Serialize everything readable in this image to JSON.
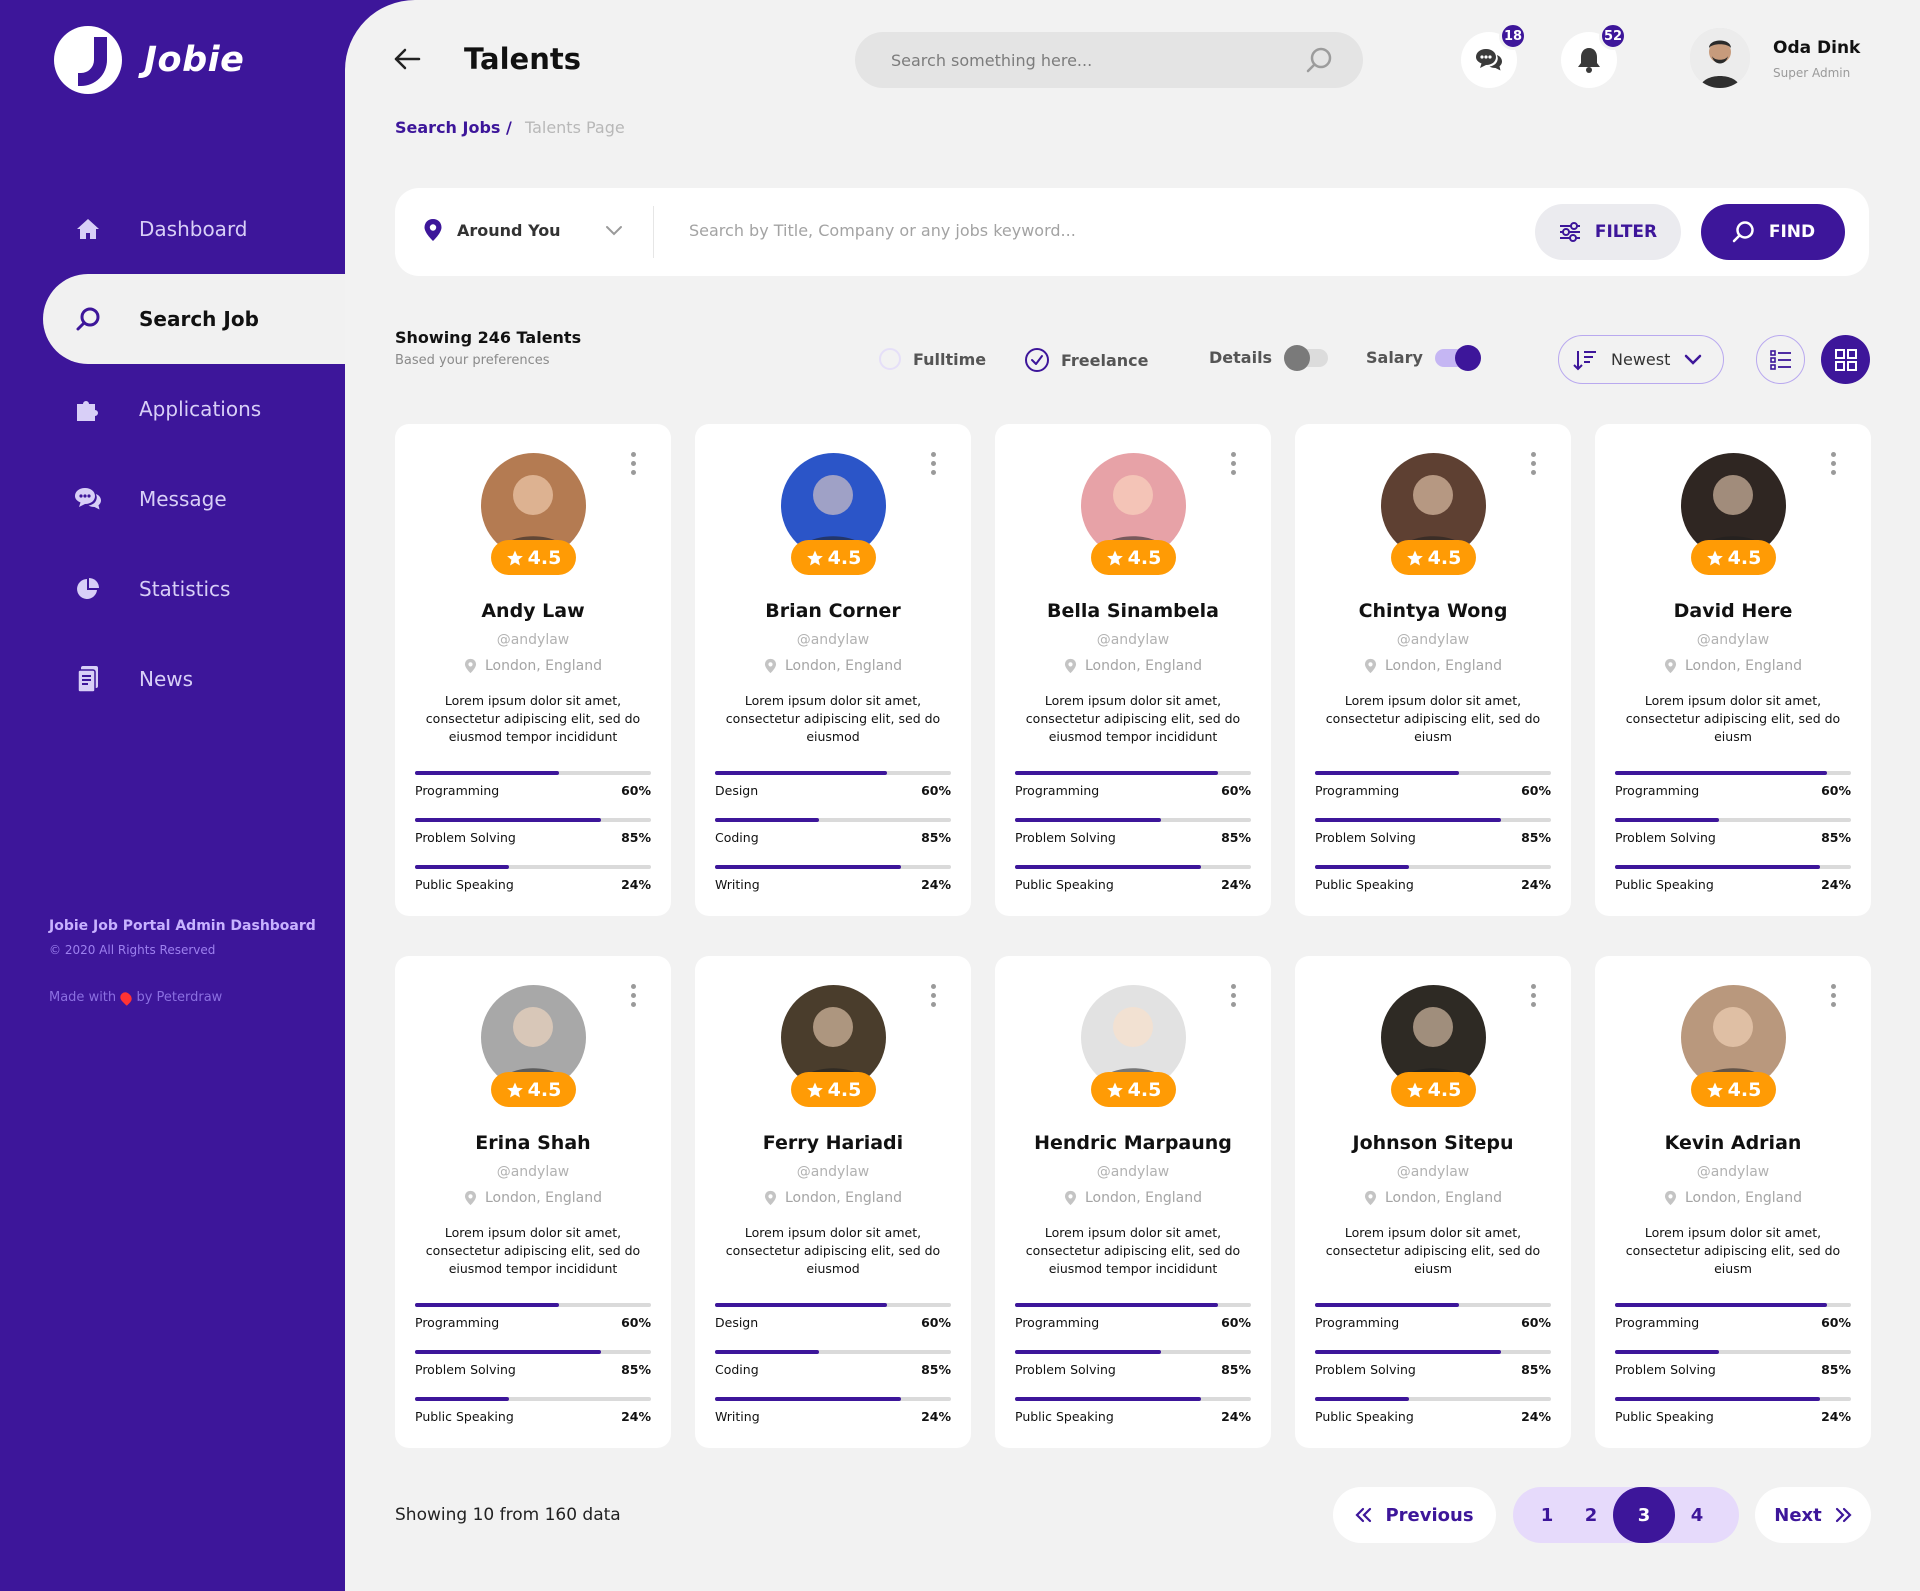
{
  "app": {
    "name": "Jobie"
  },
  "sidebar": {
    "items": [
      {
        "label": "Dashboard",
        "icon": "home-icon",
        "active": false
      },
      {
        "label": "Search Job",
        "icon": "search-icon",
        "active": true
      },
      {
        "label": "Applications",
        "icon": "puzzle-icon",
        "active": false
      },
      {
        "label": "Message",
        "icon": "chat-icon",
        "active": false
      },
      {
        "label": "Statistics",
        "icon": "pie-chart-icon",
        "active": false
      },
      {
        "label": "News",
        "icon": "document-icon",
        "active": false
      }
    ],
    "footer_title": "Jobie Job Portal Admin Dashboard",
    "footer_rights": "© 2020 All Rights Reserved",
    "made_with_prefix": "Made with",
    "made_with_suffix": "by Peterdraw"
  },
  "header": {
    "title": "Talents",
    "search_placeholder": "Search something here...",
    "messages_count": "18",
    "notifications_count": "52",
    "user_name": "Oda Dink",
    "user_role": "Super Admin"
  },
  "breadcrumb": {
    "parent": "Search Jobs /",
    "current": "Talents Page"
  },
  "searchbar": {
    "location": "Around You",
    "keyword_placeholder": "Search by Title, Company or any jobs keyword...",
    "filter_label": "FILTER",
    "find_label": "FIND"
  },
  "results": {
    "title": "Showing 246 Talents",
    "subtitle": "Based your preferences",
    "fulltime_label": "Fulltime",
    "fulltime_checked": false,
    "freelance_label": "Freelance",
    "freelance_checked": true,
    "details_label": "Details",
    "details_on": false,
    "salary_label": "Salary",
    "salary_on": true,
    "sort_label": "Newest"
  },
  "colors": {
    "accent": "#3d169a",
    "rating": "#ff9b05",
    "background": "#f2f2f2"
  },
  "talents": [
    {
      "name": "Andy Law",
      "handle": "@andylaw",
      "location": "London, England",
      "rating": "4.5",
      "desc": "Lorem ipsum dolor sit amet, consectetur adipiscing elit, sed do eiusmod tempor incididunt",
      "avatar_bg": "#b47b52",
      "skills": [
        {
          "label": "Programming",
          "value": "60%",
          "fill": 0.61
        },
        {
          "label": "Problem Solving",
          "value": "85%",
          "fill": 0.79
        },
        {
          "label": "Public Speaking",
          "value": "24%",
          "fill": 0.4
        }
      ]
    },
    {
      "name": "Brian Corner",
      "handle": "@andylaw",
      "location": "London, England",
      "rating": "4.5",
      "desc": "Lorem ipsum dolor sit amet, consectetur adipiscing elit, sed do eiusmod",
      "avatar_bg": "#2b55c8",
      "skills": [
        {
          "label": "Design",
          "value": "60%",
          "fill": 0.73
        },
        {
          "label": "Coding",
          "value": "85%",
          "fill": 0.44
        },
        {
          "label": "Writing",
          "value": "24%",
          "fill": 0.79
        }
      ]
    },
    {
      "name": "Bella Sinambela",
      "handle": "@andylaw",
      "location": "London, England",
      "rating": "4.5",
      "desc": "Lorem ipsum dolor sit amet, consectetur adipiscing elit, sed do eiusmod tempor incididunt",
      "avatar_bg": "#e7a2a7",
      "skills": [
        {
          "label": "Programming",
          "value": "60%",
          "fill": 0.86
        },
        {
          "label": "Problem Solving",
          "value": "85%",
          "fill": 0.62
        },
        {
          "label": "Public Speaking",
          "value": "24%",
          "fill": 0.79
        }
      ]
    },
    {
      "name": "Chintya Wong",
      "handle": "@andylaw",
      "location": "London, England",
      "rating": "4.5",
      "desc": "Lorem ipsum dolor sit amet, consectetur adipiscing elit, sed do eiusm",
      "avatar_bg": "#5e4032",
      "skills": [
        {
          "label": "Programming",
          "value": "60%",
          "fill": 0.61
        },
        {
          "label": "Problem Solving",
          "value": "85%",
          "fill": 0.79
        },
        {
          "label": "Public Speaking",
          "value": "24%",
          "fill": 0.4
        }
      ]
    },
    {
      "name": "David Here",
      "handle": "@andylaw",
      "location": "London, England",
      "rating": "4.5",
      "desc": "Lorem ipsum dolor sit amet, consectetur adipiscing elit, sed do eiusm",
      "avatar_bg": "#2f2622",
      "skills": [
        {
          "label": "Programming",
          "value": "60%",
          "fill": 0.9
        },
        {
          "label": "Problem Solving",
          "value": "85%",
          "fill": 0.44
        },
        {
          "label": "Public Speaking",
          "value": "24%",
          "fill": 0.87
        }
      ]
    },
    {
      "name": "Erina Shah",
      "handle": "@andylaw",
      "location": "London, England",
      "rating": "4.5",
      "desc": "Lorem ipsum dolor sit amet, consectetur adipiscing elit, sed do eiusmod tempor incididunt",
      "avatar_bg": "#a8a8a8",
      "skills": [
        {
          "label": "Programming",
          "value": "60%",
          "fill": 0.61
        },
        {
          "label": "Problem Solving",
          "value": "85%",
          "fill": 0.79
        },
        {
          "label": "Public Speaking",
          "value": "24%",
          "fill": 0.4
        }
      ]
    },
    {
      "name": "Ferry Hariadi",
      "handle": "@andylaw",
      "location": "London, England",
      "rating": "4.5",
      "desc": "Lorem ipsum dolor sit amet, consectetur adipiscing elit, sed do eiusmod",
      "avatar_bg": "#4a3d2c",
      "skills": [
        {
          "label": "Design",
          "value": "60%",
          "fill": 0.73
        },
        {
          "label": "Coding",
          "value": "85%",
          "fill": 0.44
        },
        {
          "label": "Writing",
          "value": "24%",
          "fill": 0.79
        }
      ]
    },
    {
      "name": "Hendric Marpaung",
      "handle": "@andylaw",
      "location": "London, England",
      "rating": "4.5",
      "desc": "Lorem ipsum dolor sit amet, consectetur adipiscing elit, sed do eiusmod tempor incididunt",
      "avatar_bg": "#e2e2e2",
      "skills": [
        {
          "label": "Programming",
          "value": "60%",
          "fill": 0.86
        },
        {
          "label": "Problem Solving",
          "value": "85%",
          "fill": 0.62
        },
        {
          "label": "Public Speaking",
          "value": "24%",
          "fill": 0.79
        }
      ]
    },
    {
      "name": "Johnson Sitepu",
      "handle": "@andylaw",
      "location": "London, England",
      "rating": "4.5",
      "desc": "Lorem ipsum dolor sit amet, consectetur adipiscing elit, sed do eiusm",
      "avatar_bg": "#2e2a24",
      "skills": [
        {
          "label": "Programming",
          "value": "60%",
          "fill": 0.61
        },
        {
          "label": "Problem Solving",
          "value": "85%",
          "fill": 0.79
        },
        {
          "label": "Public Speaking",
          "value": "24%",
          "fill": 0.4
        }
      ]
    },
    {
      "name": "Kevin Adrian",
      "handle": "@andylaw",
      "location": "London, England",
      "rating": "4.5",
      "desc": "Lorem ipsum dolor sit amet, consectetur adipiscing elit, sed do eiusm",
      "avatar_bg": "#b9987d",
      "skills": [
        {
          "label": "Programming",
          "value": "60%",
          "fill": 0.9
        },
        {
          "label": "Problem Solving",
          "value": "85%",
          "fill": 0.44
        },
        {
          "label": "Public Speaking",
          "value": "24%",
          "fill": 0.87
        }
      ]
    }
  ],
  "pagination": {
    "summary": "Showing 10 from 160 data",
    "previous": "Previous",
    "next": "Next",
    "pages": [
      "1",
      "2",
      "3",
      "4"
    ],
    "current": "3"
  }
}
